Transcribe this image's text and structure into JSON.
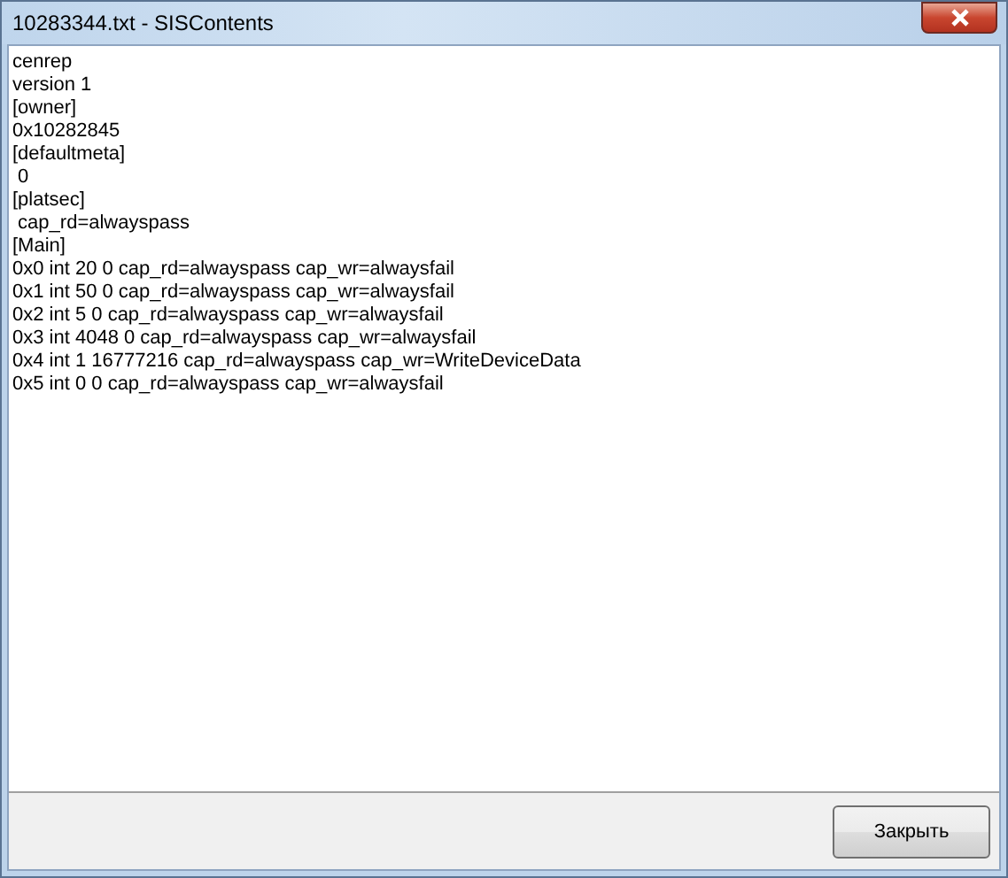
{
  "window": {
    "title": "10283344.txt - SISContents"
  },
  "content": {
    "lines": [
      "cenrep",
      "version 1",
      "[owner]",
      "0x10282845",
      "[defaultmeta]",
      " 0",
      "[platsec]",
      " cap_rd=alwayspass",
      "[Main]",
      "0x0 int 20 0 cap_rd=alwayspass cap_wr=alwaysfail",
      "0x1 int 50 0 cap_rd=alwayspass cap_wr=alwaysfail",
      "0x2 int 5 0 cap_rd=alwayspass cap_wr=alwaysfail",
      "0x3 int 4048 0 cap_rd=alwayspass cap_wr=alwaysfail",
      "0x4 int 1 16777216 cap_rd=alwayspass cap_wr=WriteDeviceData",
      "0x5 int 0 0 cap_rd=alwayspass cap_wr=alwaysfail"
    ]
  },
  "buttons": [
    {
      "label": "Закрыть"
    }
  ]
}
